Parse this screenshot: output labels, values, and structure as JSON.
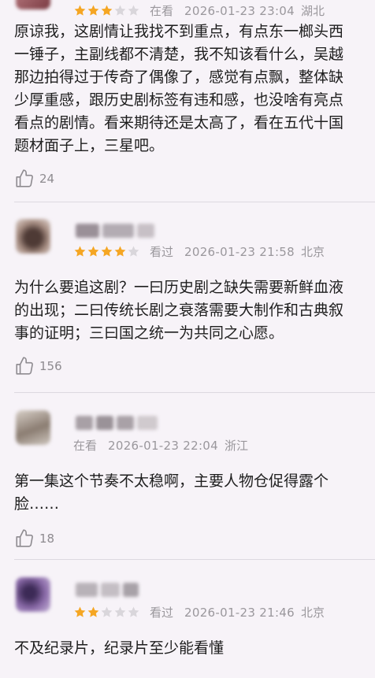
{
  "reviews": [
    {
      "stars_filled": 3,
      "stars_total": 5,
      "status": "在看",
      "date": "2026-01-23 23:04",
      "location": "湖北",
      "lines": [
        "原谅我，这剧情让我找不到重点，有点东一榔头西",
        "一锤子，主副线都不清楚，我不知该看什么，吴越",
        "那边拍得过于传奇了偶像了，感觉有点飘，整体缺",
        "少厚重感，跟历史剧标签有违和感，也没啥有亮点",
        "看点的剧情。看来期待还是太高了，看在五代十国",
        "题材面子上，三星吧。"
      ],
      "likes": "24",
      "avatar_colors": [
        "#c4858c",
        "#7a3b42"
      ]
    },
    {
      "stars_filled": 4,
      "stars_total": 5,
      "status": "看过",
      "date": "2026-01-23 21:58",
      "location": "北京",
      "lines": [
        "为什么要追这剧？一曰历史剧之缺失需要新鲜血液",
        "的出现；二曰传统长剧之衰落需要大制作和古典叙",
        "事的证明；三曰国之统一为共同之心愿。"
      ],
      "likes": "156",
      "avatar_colors": [
        "#a88f84",
        "#4e3a35"
      ]
    },
    {
      "stars_filled": 0,
      "stars_total": 0,
      "status": "在看",
      "date": "2026-01-23 22:04",
      "location": "浙江",
      "lines": [
        "第一集这个节奏不太稳啊，主要人物仓促得露个",
        "脸……"
      ],
      "likes": "18",
      "avatar_colors": [
        "#b8ada3",
        "#6c5f55"
      ]
    },
    {
      "stars_filled": 2,
      "stars_total": 5,
      "status": "看过",
      "date": "2026-01-23 21:46",
      "location": "北京",
      "lines": [
        "不及纪录片，纪录片至少能看懂"
      ],
      "likes": "",
      "avatar_colors": [
        "#8a6aa8",
        "#3c2a56"
      ]
    }
  ],
  "colors": {
    "star_filled": "#f5a623",
    "star_empty": "#d9d6db",
    "background": "#f7f3f8",
    "meta_text": "#9a979c"
  },
  "icons": {
    "thumb": "thumbs-up-icon",
    "star": "star-icon"
  }
}
